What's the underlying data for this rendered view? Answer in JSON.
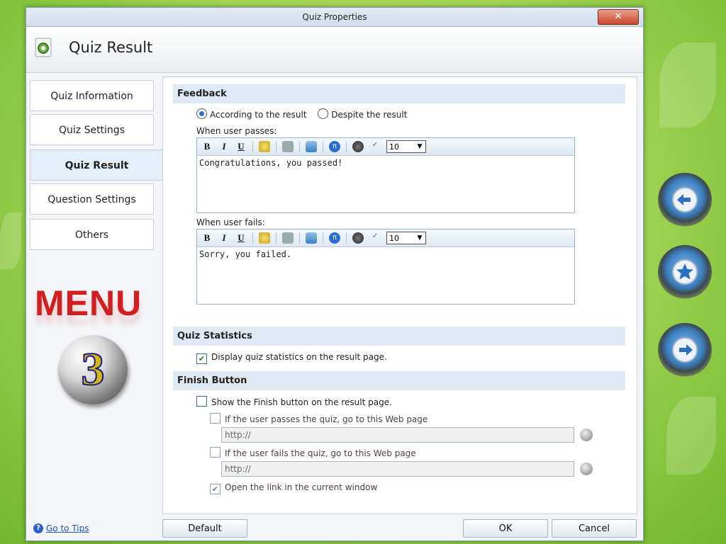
{
  "window": {
    "title": "Quiz Properties",
    "close_label": "✕"
  },
  "header": {
    "title": "Quiz Result",
    "icon": "settings-gear-icon"
  },
  "sidebar": {
    "items": [
      {
        "label": "Quiz Information"
      },
      {
        "label": "Quiz Settings"
      },
      {
        "label": "Quiz Result",
        "active": true
      },
      {
        "label": "Question Settings"
      },
      {
        "label": "Others"
      }
    ]
  },
  "overlay": {
    "menu_text": "MENU",
    "ball_number": "3"
  },
  "feedback": {
    "heading": "Feedback",
    "radio_result": "According to the result",
    "radio_despite": "Despite the result",
    "pass_label": "When user passes:",
    "fail_label": "When user fails:",
    "pass_text": "Congratulations, you passed!",
    "fail_text": "Sorry, you failed.",
    "toolbar": {
      "bold": "B",
      "italic": "I",
      "underline": "U",
      "font_size": "10"
    }
  },
  "statistics": {
    "heading": "Quiz Statistics",
    "display_label": "Display quiz statistics on the result page."
  },
  "finish": {
    "heading": "Finish Button",
    "show_label": "Show the Finish button on the result page.",
    "pass_link_label": "If the user passes the quiz, go to this Web page",
    "pass_url": "http://",
    "fail_link_label": "If the user fails the quiz, go to this Web page",
    "fail_url": "http://",
    "current_window_label": "Open the link in the current window"
  },
  "footer": {
    "tips_label": "Go to Tips",
    "default_label": "Default",
    "ok_label": "OK",
    "cancel_label": "Cancel"
  }
}
